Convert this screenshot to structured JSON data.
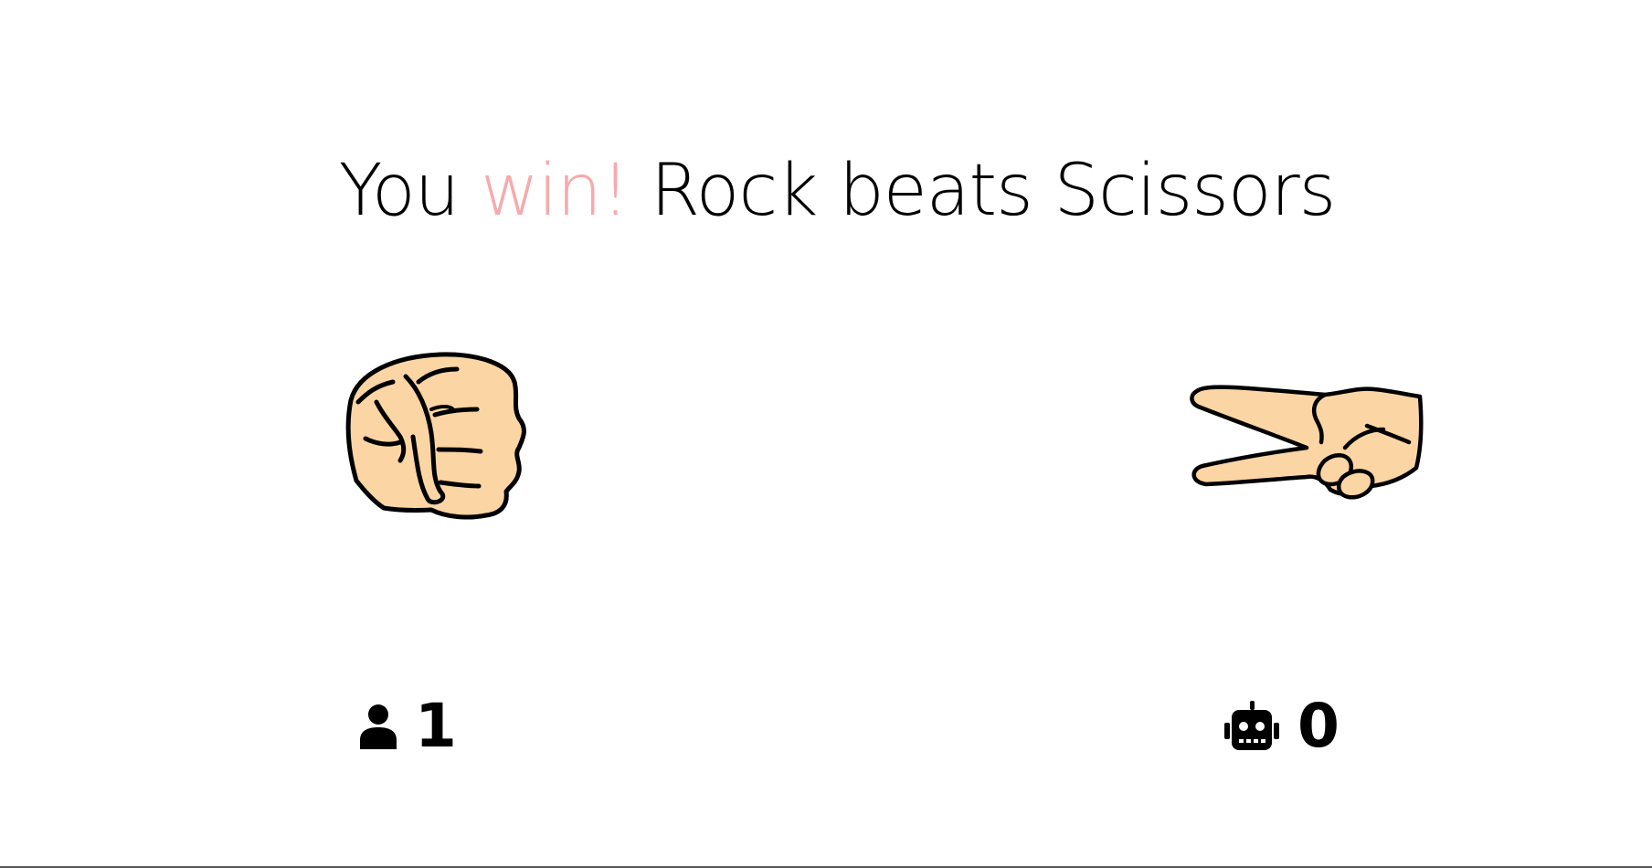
{
  "result": {
    "prefix": "You ",
    "outcome": "win!",
    "suffix": " Rock beats Scissors"
  },
  "player": {
    "choice_icon": "rock-fist-icon",
    "score_icon": "user-icon",
    "score": "1"
  },
  "computer": {
    "choice_icon": "scissors-hand-icon",
    "score_icon": "robot-icon",
    "score": "0"
  },
  "colors": {
    "win_accent": "#f6aaad",
    "skin": "#fcd5a4",
    "outline": "#000000"
  }
}
